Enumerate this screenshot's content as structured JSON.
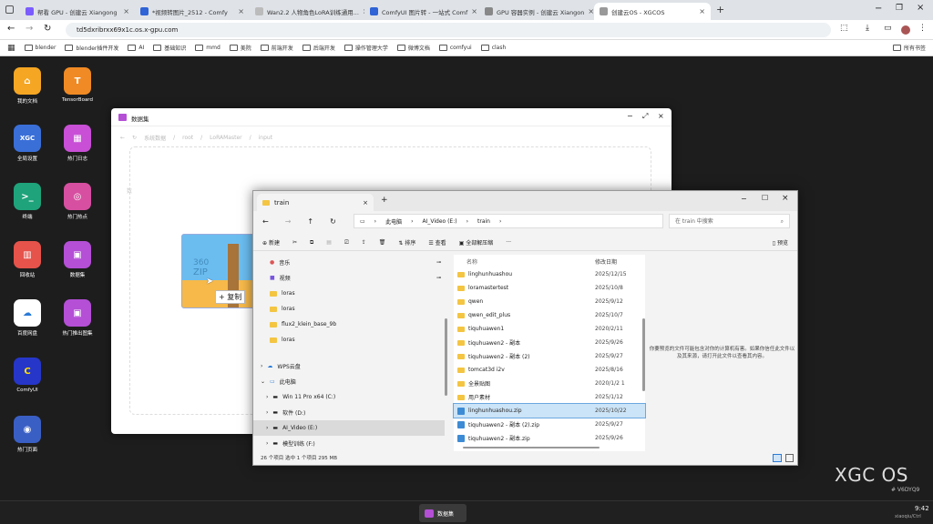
{
  "browser": {
    "tabs": [
      {
        "label": "帮看 GPU - 创建云 Xiangong",
        "color": "#7b5cff"
      },
      {
        "label": "*视频转图片_2512 - Comfy",
        "color": "#2f63d6"
      },
      {
        "label": "Wan2.2 人物角色LoRA训练通用...",
        "color": "#eee"
      },
      {
        "label": "ComfyUI 图片转 - 一站式 Comf",
        "color": "#2f63d6"
      },
      {
        "label": "GPU 容器实例 - 创建云 Xiangon",
        "color": "#888"
      },
      {
        "label": "创建云OS - XGCOS",
        "color": "#999"
      }
    ],
    "url": "td5dxribrxx69x1c.os.x-gpu.com",
    "bookmarks": [
      "blender",
      "blender插件开发",
      "AI",
      "基础知识",
      "mmd",
      "美院",
      "前端开发",
      "后端开发",
      "操作管理大学",
      "微博文档",
      "comfyui",
      "clash"
    ],
    "other_bookmarks": "所有书签"
  },
  "desktop": {
    "icons_left": [
      {
        "label": "我的文档",
        "color": "#f5a623",
        "glyph": "⌂"
      },
      {
        "label": "全局设置",
        "color": "#3a6fd8",
        "glyph": "XGC"
      },
      {
        "label": "终端",
        "color": "#1fa37a",
        "glyph": ">_"
      },
      {
        "label": "回收站",
        "color": "#e5534b",
        "glyph": "🗑"
      },
      {
        "label": "百度网盘",
        "color": "#ffffff",
        "glyph": "☁"
      },
      {
        "label": "ComfyUI",
        "color": "#2636c9",
        "glyph": "C"
      },
      {
        "label": "热门页面",
        "color": "#3a5fc4",
        "glyph": "◉"
      }
    ],
    "icons_right": [
      {
        "label": "TensorBoard",
        "color": "#f08a24",
        "glyph": "T"
      },
      {
        "label": "热门日志",
        "color": "#c84fd6",
        "glyph": "▦"
      },
      {
        "label": "热门热点",
        "color": "#d64fa0",
        "glyph": "◎"
      },
      {
        "label": "数据集",
        "color": "#b44fd6",
        "glyph": "▣"
      },
      {
        "label": "热门推出图集",
        "color": "#b44fd6",
        "glyph": "▣"
      }
    ],
    "brand": "XGC OS",
    "brand_sub": "# V6DYQ9"
  },
  "drag": {
    "zip_text": "ZIP",
    "zip_faded": "360",
    "copy_label": "+ 复制"
  },
  "win1": {
    "title": "数据集",
    "breadcrumb": [
      "系统数据",
      "root",
      "LoRAMaster",
      "input"
    ],
    "inner_label": "数"
  },
  "win2": {
    "tab_title": "train",
    "path": [
      "此电脑",
      "AI_Video (E:)",
      "train"
    ],
    "search_placeholder": "在 train 中搜索",
    "toolbar": {
      "new": "新建",
      "sort": "排序",
      "view": "查看",
      "extract": "全部解压缩",
      "more": "···",
      "details": "预览"
    },
    "sidebar": [
      {
        "label": "音乐",
        "kind": "music"
      },
      {
        "label": "视频",
        "kind": "video"
      },
      {
        "label": "loras",
        "kind": "folder"
      },
      {
        "label": "loras",
        "kind": "folder"
      },
      {
        "label": "flux2_klein_base_9b",
        "kind": "folder"
      },
      {
        "label": "loras",
        "kind": "folder"
      },
      {
        "label": "WPS云盘",
        "kind": "cloud"
      },
      {
        "label": "此电脑",
        "kind": "pc"
      },
      {
        "label": "Win 11 Pro x64 (C:)",
        "kind": "drive"
      },
      {
        "label": "软件 (D:)",
        "kind": "drive"
      },
      {
        "label": "AI_Video (E:)",
        "kind": "drive"
      },
      {
        "label": "模型训练 (F:)",
        "kind": "drive"
      }
    ],
    "col_name": "名称",
    "col_date": "修改日期",
    "files": [
      {
        "name": "linghunhuashou",
        "date": "2025/12/15",
        "zip": false
      },
      {
        "name": "loramastertest",
        "date": "2025/10/8",
        "zip": false
      },
      {
        "name": "qwen",
        "date": "2025/9/12",
        "zip": false
      },
      {
        "name": "qwen_edit_plus",
        "date": "2025/10/7",
        "zip": false
      },
      {
        "name": "tiquhuawen1",
        "date": "2020/2/11",
        "zip": false
      },
      {
        "name": "tiquhuawen2 - 副本",
        "date": "2025/9/26",
        "zip": false
      },
      {
        "name": "tiquhuawen2 - 副本 (2)",
        "date": "2025/9/27",
        "zip": false
      },
      {
        "name": "tomcat3d i2v",
        "date": "2025/8/16",
        "zip": false
      },
      {
        "name": "全景贴图",
        "date": "2020/1/2 1",
        "zip": false
      },
      {
        "name": "用户素材",
        "date": "2025/1/12",
        "zip": false
      },
      {
        "name": "linghunhuashou.zip",
        "date": "2025/10/22",
        "zip": true,
        "selected": true
      },
      {
        "name": "tiquhuawen2 - 副本 (2).zip",
        "date": "2025/9/27",
        "zip": true
      },
      {
        "name": "tiquhuawen2 - 副本.zip",
        "date": "2025/9/26",
        "zip": true
      }
    ],
    "preview_text": "你要预览的文件可能包含对你的计算机有害。如果你信任此文件以及其来源，请打开此文件以查看其内容。",
    "status": "26 个项目    选中 1 个项目  295 MB"
  },
  "taskbar": {
    "item": "数据集",
    "time": "9:42",
    "user": "xiaoqiu/Ctrl"
  }
}
